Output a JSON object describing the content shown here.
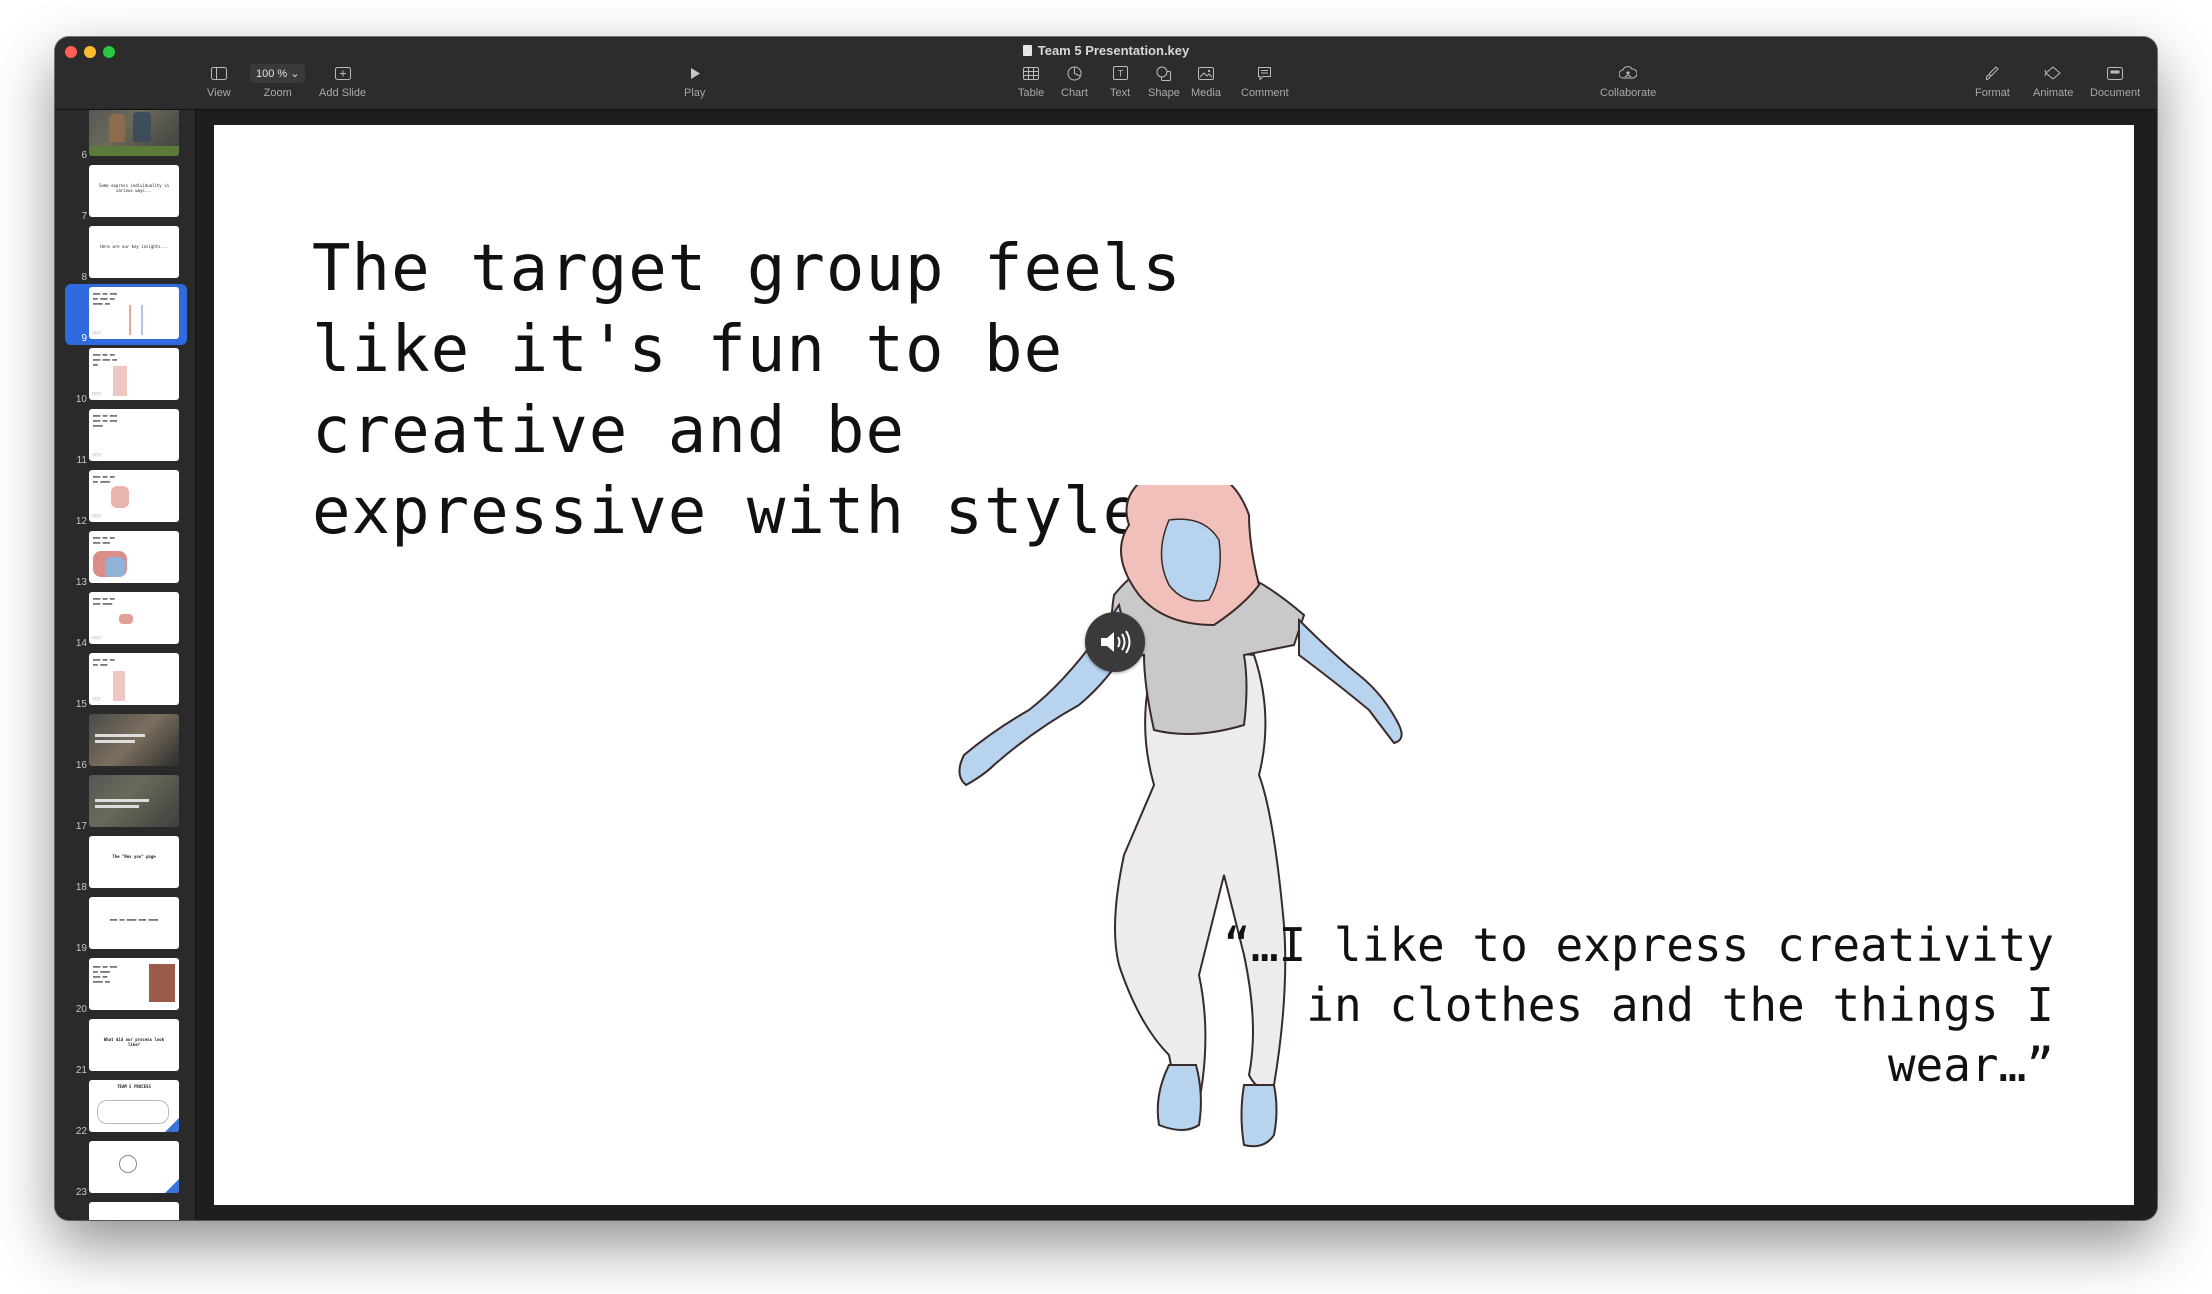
{
  "window": {
    "title": "Team 5 Presentation.key"
  },
  "toolbar": {
    "view": "View",
    "zoom_value": "100 %",
    "zoom": "Zoom",
    "add_slide": "Add Slide",
    "play": "Play",
    "table": "Table",
    "chart": "Chart",
    "text": "Text",
    "shape": "Shape",
    "media": "Media",
    "comment": "Comment",
    "collaborate": "Collaborate",
    "format": "Format",
    "animate": "Animate",
    "document": "Document"
  },
  "navigator": {
    "selected_slide": "9",
    "slides": [
      {
        "number": "6"
      },
      {
        "number": "7",
        "text": "Some express individuality in various ways..."
      },
      {
        "number": "8",
        "text": "Here are our key insights..."
      },
      {
        "number": "9"
      },
      {
        "number": "10"
      },
      {
        "number": "11"
      },
      {
        "number": "12"
      },
      {
        "number": "13"
      },
      {
        "number": "14"
      },
      {
        "number": "15"
      },
      {
        "number": "16"
      },
      {
        "number": "17"
      },
      {
        "number": "18",
        "text": "The \"Rex you\" page"
      },
      {
        "number": "19"
      },
      {
        "number": "20"
      },
      {
        "number": "21",
        "text": "What did our process look like?"
      },
      {
        "number": "22",
        "text": "TEAM 5 PROCESS"
      },
      {
        "number": "23"
      }
    ]
  },
  "slide": {
    "headline": "The target group feels like it's fun to be creative and be expressive with styles.",
    "quote": "“…I like to express creativity in clothes and the things I wear…”"
  }
}
